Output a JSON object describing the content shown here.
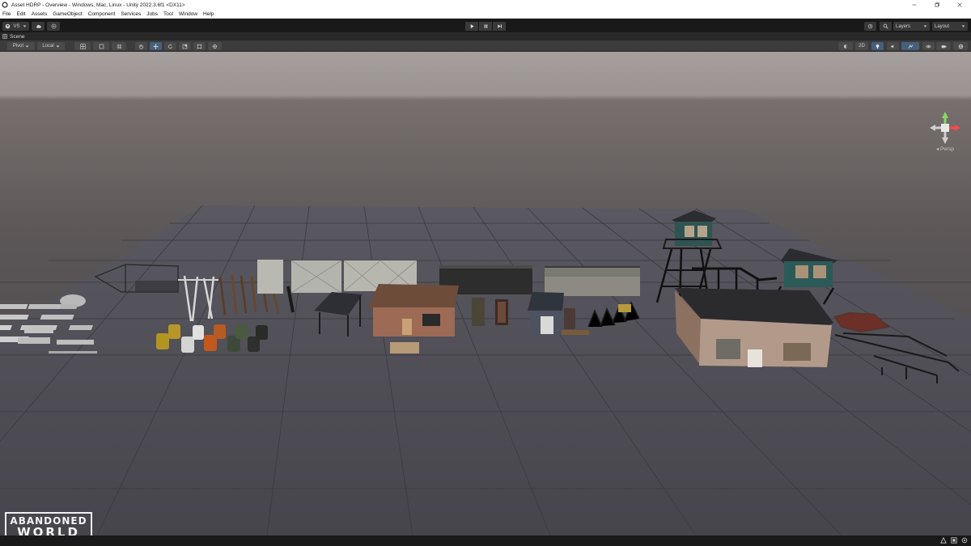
{
  "window": {
    "title": "Asset HDRP - Overview - Windows, Mac, Linux - Unity 2022.3.6f1 <DX11>"
  },
  "menu": [
    "File",
    "Edit",
    "Assets",
    "GameObject",
    "Component",
    "Services",
    "Jobs",
    "Tool",
    "Window",
    "Help"
  ],
  "toolbar": {
    "account_label": "VS",
    "layers_label": "Layers",
    "layout_label": "Layout"
  },
  "scene": {
    "tab_label": "Scene",
    "pivot_label": "Pivot",
    "local_label": "Local",
    "mode_2d_label": "2D",
    "camera_label": "Persp"
  },
  "logo": {
    "line1": "ABANDONED",
    "line2": "WORLD"
  },
  "colors": {
    "editor_dark": "#191919",
    "scene_toolbar": "#3c3c3c",
    "active_tool": "#46607c",
    "ground": "#4d4c54",
    "sky": "#a29b99"
  }
}
